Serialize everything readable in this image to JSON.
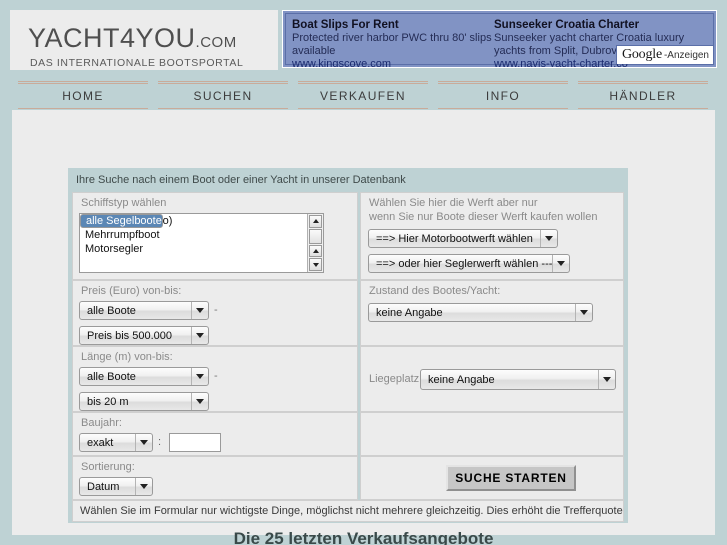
{
  "site": {
    "logo_main": "YACHT4YOU",
    "logo_dotcom": ".COM",
    "logo_sub": "DAS INTERNATIONALE BOOTSPORTAL"
  },
  "ads": {
    "badge_word": "Google",
    "badge_suffix": "-Anzeigen",
    "items": [
      {
        "title": "Boat Slips For Rent",
        "line1": "Protected river harbor PWC thru 80' slips",
        "line2": "available",
        "url": "www.kingscove.com"
      },
      {
        "title": "Sunseeker Croatia Charter",
        "line1": "Sunseeker yacht charter Croatia luxury",
        "line2": "yachts from Split, Dubrovnik",
        "url": "www.navis-yacht-charter.co"
      }
    ]
  },
  "nav": {
    "items": [
      {
        "label": "HOME"
      },
      {
        "label": "SUCHEN"
      },
      {
        "label": "VERKAUFEN"
      },
      {
        "label": "INFO"
      },
      {
        "label": "HÄNDLER"
      }
    ]
  },
  "form": {
    "heading": "Ihre Suche nach einem Boot oder einer Yacht in unserer Datenbank",
    "shiptype": {
      "label": "Schiffstyp wählen",
      "options": [
        "alle Segelboote",
        "Segelboot (Mono)",
        "Mehrrumpfboot",
        "Motorsegler"
      ],
      "selected_index": 0
    },
    "werft": {
      "label_line1": "Wählen Sie hier die Werft aber nur",
      "label_line2": "wenn Sie nur Boote dieser Werft kaufen wollen",
      "motor_value": "==> Hier Motorbootwerft wählen",
      "segler_value": "==> oder hier Seglerwerft wählen -----"
    },
    "preis": {
      "label": "Preis (Euro) von-bis:",
      "from_value": "alle Boote",
      "separator": "-",
      "to_value": "Preis bis 500.000"
    },
    "zustand": {
      "label": "Zustand des Bootes/Yacht:",
      "value": "keine Angabe"
    },
    "laenge": {
      "label": "Länge (m) von-bis:",
      "from_value": "alle Boote",
      "separator": "-",
      "to_value": "bis 20 m"
    },
    "liegeplatz": {
      "label": "Liegeplatz:",
      "value": "keine Angabe"
    },
    "baujahr": {
      "label": "Baujahr:",
      "mode_value": "exakt",
      "separator": ":",
      "year_value": "",
      "year_placeholder": ""
    },
    "sortierung": {
      "label": "Sortierung:",
      "value": "Datum"
    },
    "submit_label": "SUCHE STARTEN",
    "hint": "Wählen Sie im Formular nur wichtigste Dinge, möglichst nicht mehrere gleichzeitig. Dies erhöht die Trefferquote"
  },
  "bottom": {
    "title": "Die 25 letzten Verkaufsangebote"
  },
  "colors": {
    "page_bg": "#bed2d4",
    "content_bg": "#ececec",
    "ad_bg": "#8193c4",
    "nav_rule": "#c9ab9a",
    "list_selected": "#5b87b5"
  }
}
